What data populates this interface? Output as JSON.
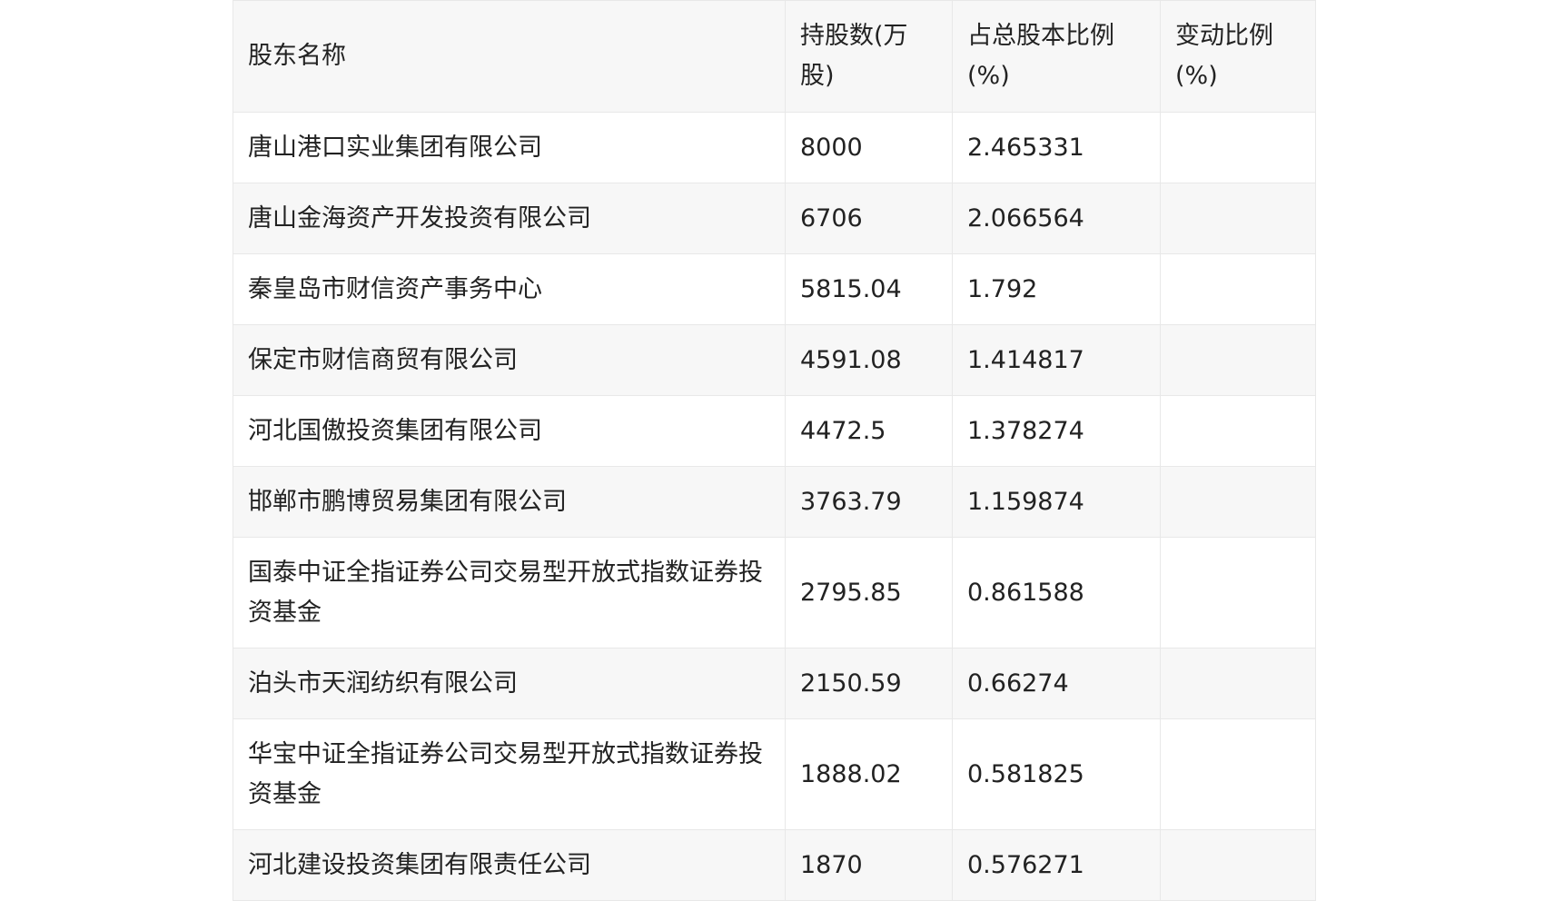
{
  "table": {
    "headers": [
      "股东名称",
      "持股数(万股)",
      "占总股本比例(%)",
      "变动比例(%)"
    ],
    "rows": [
      {
        "name": "唐山港口实业集团有限公司",
        "shares": "8000",
        "ratio": "2.465331",
        "change": ""
      },
      {
        "name": "唐山金海资产开发投资有限公司",
        "shares": "6706",
        "ratio": "2.066564",
        "change": ""
      },
      {
        "name": "秦皇岛市财信资产事务中心",
        "shares": "5815.04",
        "ratio": "1.792",
        "change": ""
      },
      {
        "name": "保定市财信商贸有限公司",
        "shares": "4591.08",
        "ratio": "1.414817",
        "change": ""
      },
      {
        "name": "河北国傲投资集团有限公司",
        "shares": "4472.5",
        "ratio": "1.378274",
        "change": ""
      },
      {
        "name": "邯郸市鹏博贸易集团有限公司",
        "shares": "3763.79",
        "ratio": "1.159874",
        "change": ""
      },
      {
        "name": "国泰中证全指证券公司交易型开放式指数证券投资基金",
        "shares": "2795.85",
        "ratio": "0.861588",
        "change": ""
      },
      {
        "name": "泊头市天润纺织有限公司",
        "shares": "2150.59",
        "ratio": "0.66274",
        "change": ""
      },
      {
        "name": "华宝中证全指证券公司交易型开放式指数证券投资基金",
        "shares": "1888.02",
        "ratio": "0.581825",
        "change": ""
      },
      {
        "name": "河北建设投资集团有限责任公司",
        "shares": "1870",
        "ratio": "0.576271",
        "change": ""
      }
    ]
  }
}
